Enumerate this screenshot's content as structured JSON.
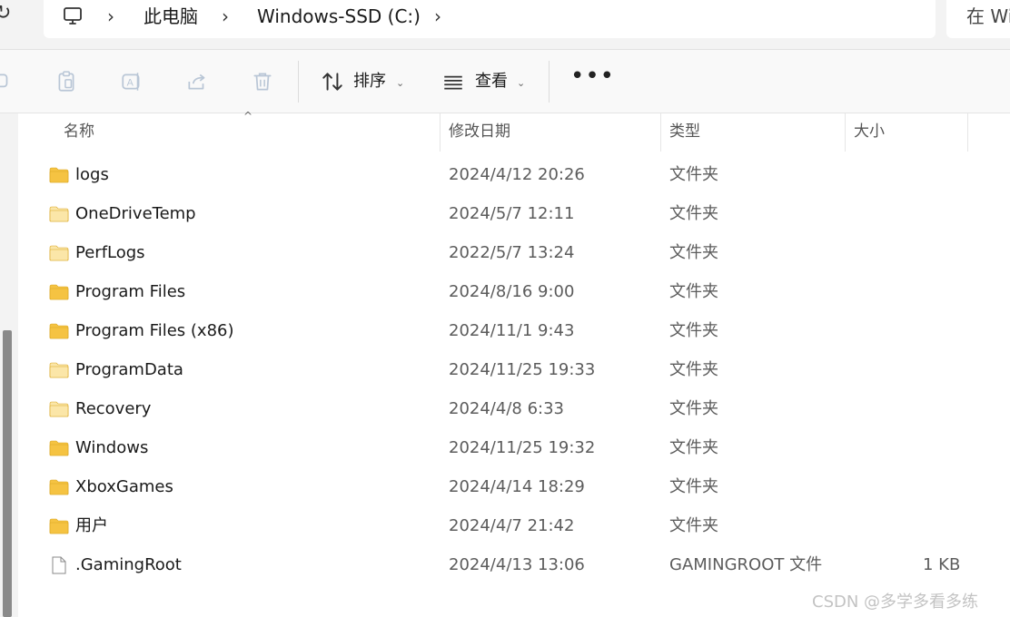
{
  "address_bar": {
    "breadcrumbs": [
      "此电脑",
      "Windows-SSD (C:)"
    ],
    "search_placeholder": "在 Wi"
  },
  "toolbar": {
    "sort_label": "排序",
    "view_label": "查看",
    "more_label": "•••"
  },
  "columns": {
    "name": "名称",
    "date": "修改日期",
    "type": "类型",
    "size": "大小"
  },
  "files": [
    {
      "name": "logs",
      "date": "2024/4/12 20:26",
      "type": "文件夹",
      "size": "",
      "icon": "folder-icon"
    },
    {
      "name": "OneDriveTemp",
      "date": "2024/5/7 12:11",
      "type": "文件夹",
      "size": "",
      "icon": "folder-hidden-icon"
    },
    {
      "name": "PerfLogs",
      "date": "2022/5/7 13:24",
      "type": "文件夹",
      "size": "",
      "icon": "folder-hidden-icon"
    },
    {
      "name": "Program Files",
      "date": "2024/8/16 9:00",
      "type": "文件夹",
      "size": "",
      "icon": "folder-icon"
    },
    {
      "name": "Program Files (x86)",
      "date": "2024/11/1 9:43",
      "type": "文件夹",
      "size": "",
      "icon": "folder-icon"
    },
    {
      "name": "ProgramData",
      "date": "2024/11/25 19:33",
      "type": "文件夹",
      "size": "",
      "icon": "folder-hidden-icon"
    },
    {
      "name": "Recovery",
      "date": "2024/4/8 6:33",
      "type": "文件夹",
      "size": "",
      "icon": "folder-hidden-icon"
    },
    {
      "name": "Windows",
      "date": "2024/11/25 19:32",
      "type": "文件夹",
      "size": "",
      "icon": "folder-icon"
    },
    {
      "name": "XboxGames",
      "date": "2024/4/14 18:29",
      "type": "文件夹",
      "size": "",
      "icon": "folder-icon"
    },
    {
      "name": "用户",
      "date": "2024/4/7 21:42",
      "type": "文件夹",
      "size": "",
      "icon": "folder-icon"
    },
    {
      "name": ".GamingRoot",
      "date": "2024/4/13 13:06",
      "type": "GAMINGROOT 文件",
      "size": "1 KB",
      "icon": "file-icon"
    }
  ],
  "watermark": "CSDN @多学多看多练",
  "colors": {
    "folder": "#f5c342",
    "folder_hidden": "#fbe6a8",
    "text_secondary": "#5c5c5c"
  }
}
